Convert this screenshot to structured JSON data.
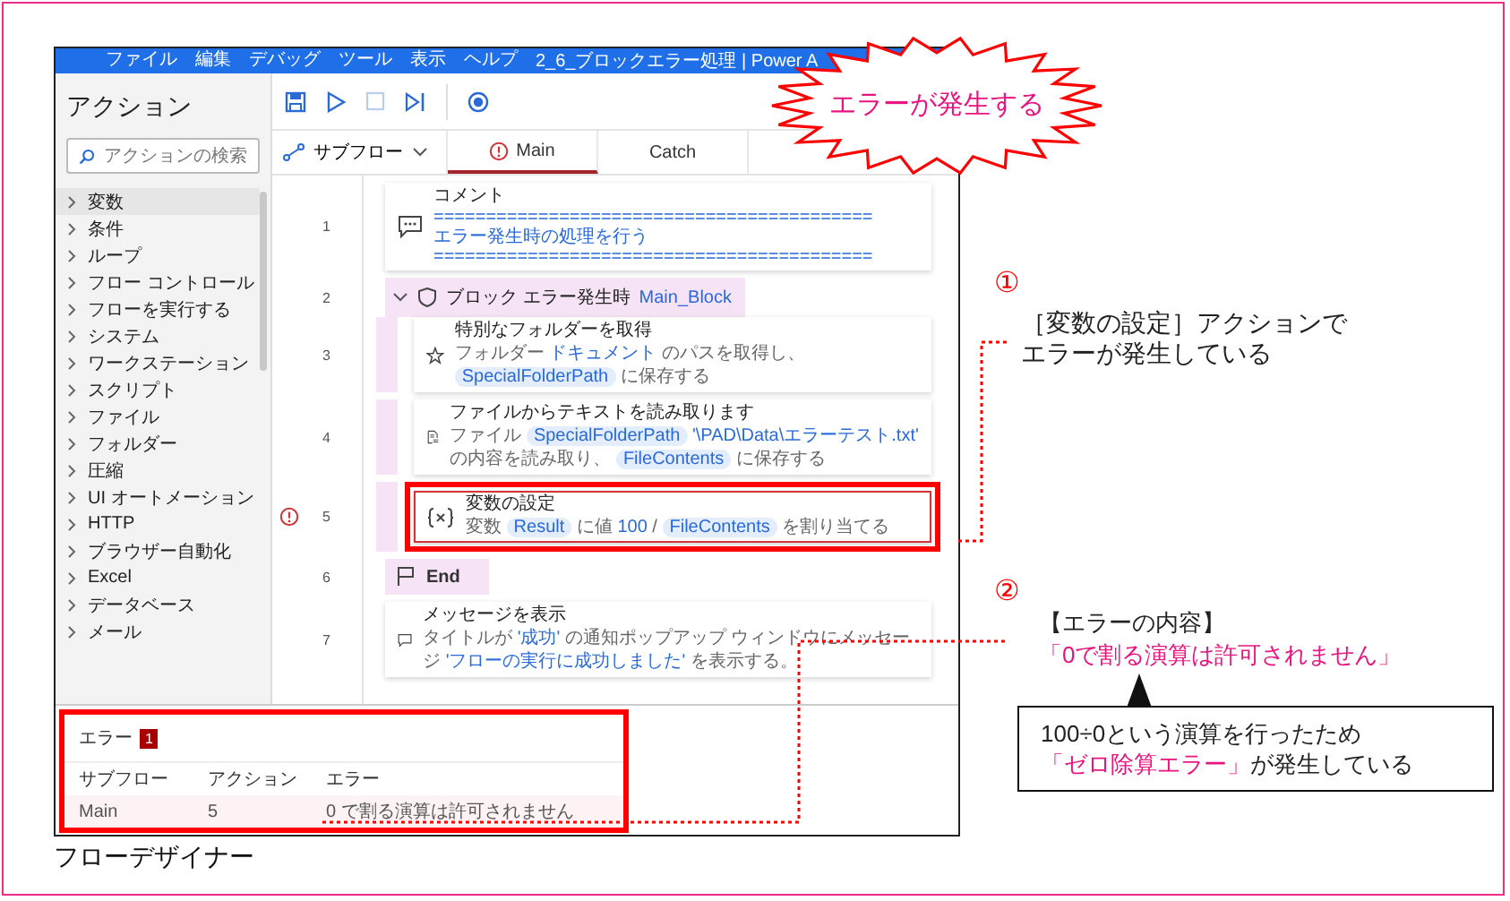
{
  "window": {
    "title": "2_6_ブロックエラー処理 | Power A",
    "menu": [
      "ファイル",
      "編集",
      "デバッグ",
      "ツール",
      "表示",
      "ヘルプ"
    ]
  },
  "sidebar": {
    "title": "アクション",
    "search": {
      "placeholder": "アクションの検索"
    },
    "items": [
      {
        "label": "変数",
        "selected": true
      },
      {
        "label": "条件",
        "selected": false
      },
      {
        "label": "ループ",
        "selected": false
      },
      {
        "label": "フロー コントロール",
        "selected": false
      },
      {
        "label": "フローを実行する",
        "selected": false
      },
      {
        "label": "システム",
        "selected": false
      },
      {
        "label": "ワークステーション",
        "selected": false
      },
      {
        "label": "スクリプト",
        "selected": false
      },
      {
        "label": "ファイル",
        "selected": false
      },
      {
        "label": "フォルダー",
        "selected": false
      },
      {
        "label": "圧縮",
        "selected": false
      },
      {
        "label": "UI オートメーション",
        "selected": false
      },
      {
        "label": "HTTP",
        "selected": false
      },
      {
        "label": "ブラウザー自動化",
        "selected": false
      },
      {
        "label": "Excel",
        "selected": false
      },
      {
        "label": "データベース",
        "selected": false
      },
      {
        "label": "メール",
        "selected": false
      }
    ]
  },
  "tabs": {
    "subflow_dropdown": "サブフロー",
    "items": [
      {
        "label": "Main",
        "selected": true,
        "error": true
      },
      {
        "label": "Catch",
        "selected": false,
        "error": false
      }
    ]
  },
  "steps": [
    {
      "number": "1",
      "kind": "comment",
      "title": "コメント",
      "lines": [
        "==========================================",
        "エラー発生時の処理を行う",
        "=========================================="
      ],
      "error": false,
      "highlighted": false
    },
    {
      "number": "2",
      "kind": "block",
      "title": "ブロック エラー発生時",
      "name": "Main_Block",
      "expanded": true,
      "children": [
        {
          "number": "3",
          "kind": "special_folder",
          "title": "特別なフォルダーを取得",
          "description": [
            {
              "kind": "text",
              "text": "フォルダー"
            },
            {
              "kind": "value",
              "text": "ドキュメント"
            },
            {
              "kind": "text",
              "text": "のパスを取得し、"
            },
            {
              "kind": "variable",
              "text": "SpecialFolderPath"
            },
            {
              "kind": "text",
              "text": "に保存する"
            }
          ],
          "error": false,
          "highlighted": false
        },
        {
          "number": "4",
          "kind": "read_file",
          "title": "ファイルからテキストを読み取ります",
          "description": [
            {
              "kind": "text",
              "text": "ファイル"
            },
            {
              "kind": "variable",
              "text": "SpecialFolderPath"
            },
            {
              "kind": "value",
              "text": "'\\PAD\\Data\\エラーテスト.txt'"
            },
            {
              "kind": "text",
              "text": "の内容を読み取り、"
            },
            {
              "kind": "variable",
              "text": "FileContents"
            },
            {
              "kind": "text",
              "text": "に保存する"
            }
          ],
          "error": false,
          "highlighted": false
        },
        {
          "number": "5",
          "kind": "set_variable",
          "title": "変数の設定",
          "description": [
            {
              "kind": "text",
              "text": "変数"
            },
            {
              "kind": "variable",
              "text": "Result"
            },
            {
              "kind": "text",
              "text": "に値"
            },
            {
              "kind": "value",
              "text": "100"
            },
            {
              "kind": "text",
              "text": "/"
            },
            {
              "kind": "variable",
              "text": "FileContents"
            },
            {
              "kind": "text",
              "text": "を割り当てる"
            }
          ],
          "error": true,
          "highlighted": true
        }
      ]
    },
    {
      "number": "6",
      "kind": "block_end",
      "title": "End"
    },
    {
      "number": "7",
      "kind": "message",
      "title": "メッセージを表示",
      "description": [
        {
          "kind": "text",
          "text": "タイトルが"
        },
        {
          "kind": "value",
          "text": "'成功'"
        },
        {
          "kind": "text",
          "text": "の通知ポップアップ ウィンドウにメッセージ"
        },
        {
          "kind": "value",
          "text": "'フローの実行に成功しました'"
        },
        {
          "kind": "text",
          "text": "を表示する。"
        }
      ],
      "error": false,
      "highlighted": false
    }
  ],
  "error_panel": {
    "title": "エラー",
    "count": "1",
    "highlighted": true,
    "columns": [
      "サブフロー",
      "アクション",
      "エラー"
    ],
    "rows": [
      [
        "Main",
        "5",
        "0 で割る演算は許可されません"
      ]
    ]
  },
  "annotations": {
    "burst": "エラーが発生する",
    "notes": [
      {
        "number": "①",
        "lines": [
          "［変数の設定］アクションで",
          "エラーが発生している"
        ]
      },
      {
        "number": "②",
        "heading": "【エラーの内容】",
        "quote": "「0で割る演算は許可されません」"
      }
    ],
    "callout": [
      [
        {
          "text": "100÷0という演算を行ったため",
          "emphasis": false
        }
      ],
      [
        {
          "text": "「ゼロ除算エラー」",
          "emphasis": true
        },
        {
          "text": "が発生している",
          "emphasis": false
        }
      ]
    ]
  },
  "caption": "フローデザイナー"
}
